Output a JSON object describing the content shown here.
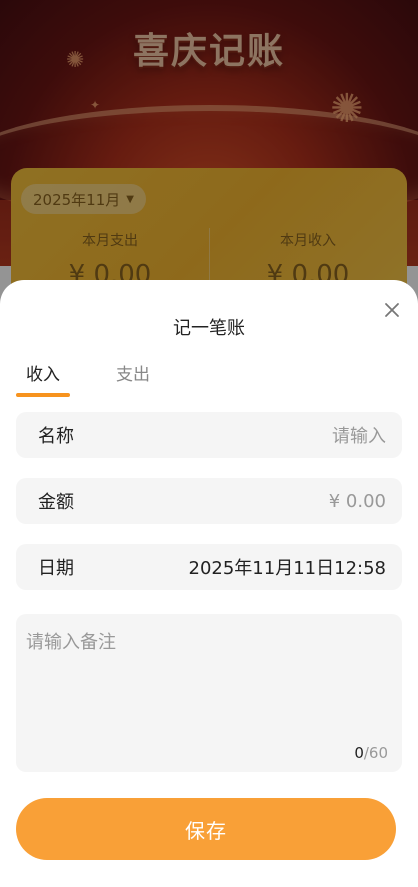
{
  "app": {
    "title": "喜庆记账",
    "month_selector": "2025年11月",
    "expense_label": "本月支出",
    "expense_value": "¥ 0.00",
    "income_label": "本月收入",
    "income_value": "¥ 0.00"
  },
  "sheet": {
    "title": "记一笔账",
    "tabs": [
      {
        "label": "收入",
        "active": true
      },
      {
        "label": "支出",
        "active": false
      }
    ],
    "fields": {
      "name": {
        "label": "名称",
        "placeholder": "请输入"
      },
      "amount": {
        "label": "金额",
        "placeholder": "¥ 0.00"
      },
      "date": {
        "label": "日期",
        "value": "2025年11月11日12:58"
      }
    },
    "note": {
      "placeholder": "请输入备注",
      "count": "0",
      "max": "/60"
    },
    "save_label": "保存"
  },
  "colors": {
    "accent": "#f7931e",
    "save_button": "#f9a037",
    "card": "#f5b630"
  },
  "icons": {
    "close": "close-icon",
    "caret": "caret-down-icon"
  }
}
